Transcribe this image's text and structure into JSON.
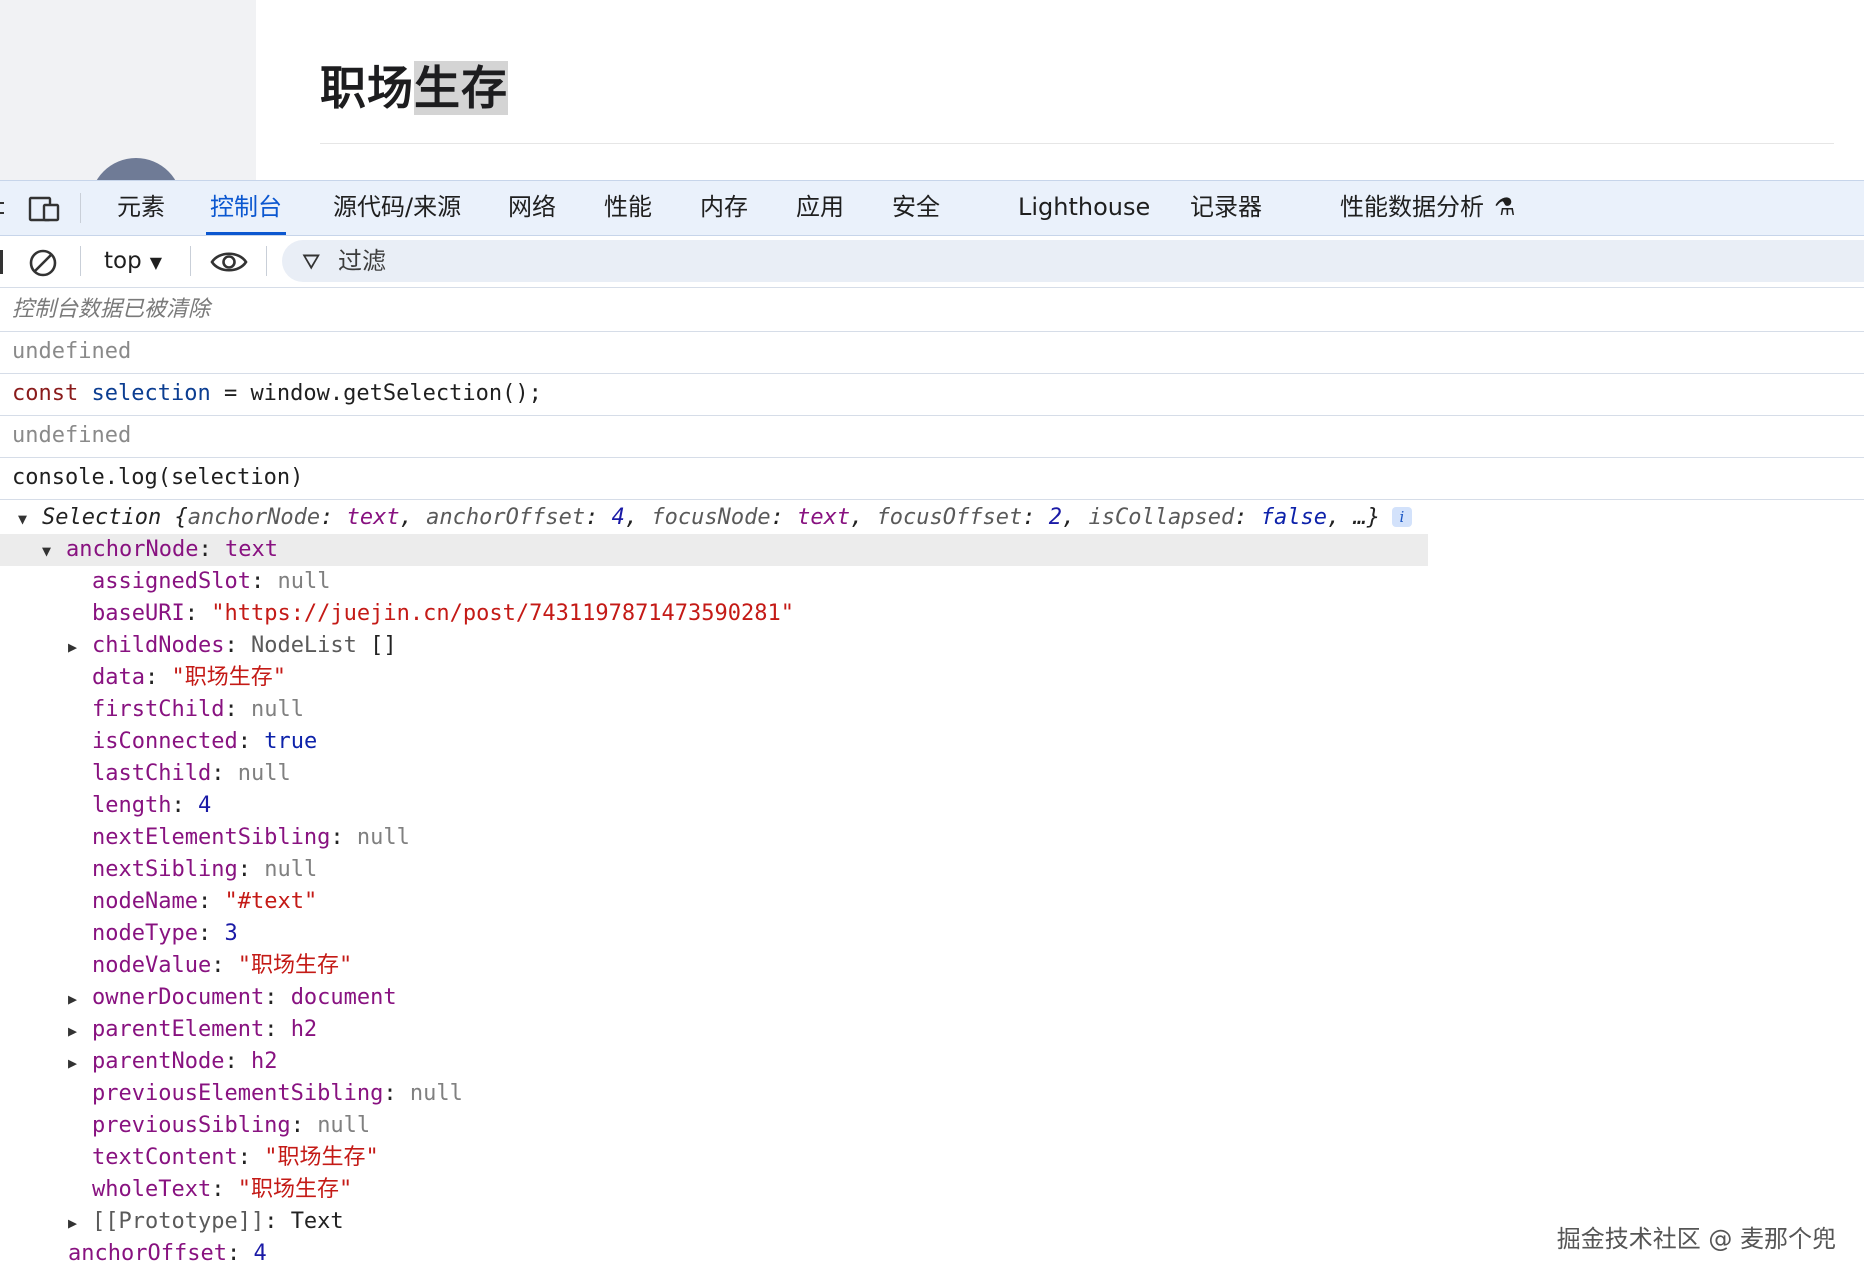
{
  "page": {
    "title_plain": "职场",
    "title_selected": "生存"
  },
  "tabs": [
    {
      "label": "元素"
    },
    {
      "label": "控制台",
      "active": true
    },
    {
      "label": "源代码/来源"
    },
    {
      "label": "网络"
    },
    {
      "label": "性能"
    },
    {
      "label": "内存"
    },
    {
      "label": "应用"
    },
    {
      "label": "安全"
    },
    {
      "label": "Lighthouse"
    },
    {
      "label": "记录器"
    },
    {
      "label": "性能数据分析"
    }
  ],
  "toolbar": {
    "context": "top",
    "filter_label": "过滤"
  },
  "console": {
    "cleared": "控制台数据已被清除",
    "undefined1": "undefined",
    "cmd1": {
      "kw": "const",
      "var": "selection",
      "rest": " = window.getSelection();"
    },
    "undefined2": "undefined",
    "cmd2": "console.log(selection)"
  },
  "selection": {
    "class": "Selection",
    "summary": [
      {
        "key": "anchorNode",
        "val": "text"
      },
      {
        "key": "anchorOffset",
        "val": "4"
      },
      {
        "key": "focusNode",
        "val": "text"
      },
      {
        "key": "focusOffset",
        "val": "2"
      },
      {
        "key": "isCollapsed",
        "val": "false"
      }
    ],
    "ellipsis": "…}"
  },
  "anchorNode": {
    "key": "anchorNode",
    "val": "text",
    "props": {
      "assignedSlot": "null",
      "baseURI": "\"https://juejin.cn/post/7431197871473590281\"",
      "childNodes": "NodeList",
      "childNodes_extra": "[]",
      "data": "\"职场生存\"",
      "firstChild": "null",
      "isConnected": "true",
      "lastChild": "null",
      "length": "4",
      "nextElementSibling": "null",
      "nextSibling": "null",
      "nodeName": "\"#text\"",
      "nodeType": "3",
      "nodeValue": "\"职场生存\"",
      "ownerDocument": "document",
      "parentElement": "h2",
      "parentNode": "h2",
      "previousElementSibling": "null",
      "previousSibling": "null",
      "textContent": "\"职场生存\"",
      "wholeText": "\"职场生存\"",
      "prototype_key": "[[Prototype]]",
      "prototype_val": "Text"
    }
  },
  "anchorOffset": {
    "key": "anchorOffset",
    "val": "4"
  },
  "watermark": "掘金技术社区 @ 麦那个兜"
}
